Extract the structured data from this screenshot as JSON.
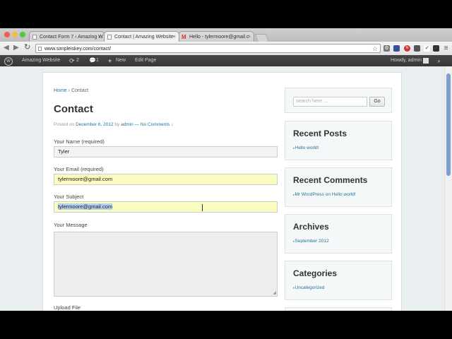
{
  "browser": {
    "tabs": [
      {
        "title": "Contact Form 7 ‹ Amazing W",
        "active": false
      },
      {
        "title": "Contact | Amazing Website",
        "active": true
      },
      {
        "title": "Hello - tylermoore@gmail.c",
        "active": false
      }
    ],
    "tab_close": "×",
    "url": "www.simpleiskey.com/contact/",
    "colors": {
      "close": "#ee5b52",
      "min": "#f3bc3e",
      "max": "#55c543"
    }
  },
  "adminbar": {
    "wp_logo": "W",
    "site": "Amazing Website",
    "updates": "2",
    "comments": "1",
    "new": "New",
    "edit": "Edit Page",
    "howdy": "Howdy, admin"
  },
  "breadcrumb": {
    "home": "Home",
    "sep": "›",
    "current": "Contact"
  },
  "post": {
    "title": "Contact",
    "posted_on": "Posted on",
    "date": "December 6, 2012",
    "by": "by",
    "author": "admin",
    "dash": "—",
    "comments": "No Comments ↓"
  },
  "form": {
    "name_label": "Your Name (required)",
    "name_value": "Tyler",
    "email_label": "Your Email (required)",
    "email_value": "tylermoore@gmail.com",
    "subject_label": "Your Subject",
    "subject_value": "tylermoore@gmail.com",
    "message_label": "Your Message",
    "upload_label": "Upload File"
  },
  "sidebar": {
    "search_placeholder": "search here …",
    "search_button": "Go",
    "recent_posts_title": "Recent Posts",
    "recent_posts": [
      "Hello world!"
    ],
    "recent_comments_title": "Recent Comments",
    "recent_comments": [
      "Mr WordPress on Hello world!"
    ],
    "archives_title": "Archives",
    "archives": [
      "September 2012"
    ],
    "categories_title": "Categories",
    "categories": [
      "Uncategorized"
    ]
  }
}
